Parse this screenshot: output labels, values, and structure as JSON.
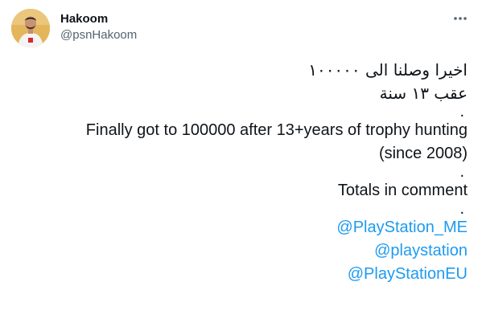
{
  "tweet": {
    "author_name": "Hakoom",
    "author_handle": "@psnHakoom",
    "more_icon": "ellipsis-icon",
    "lines": [
      "اخيرا وصلنا الى ١٠٠٠٠٠",
      "عقب ١٣ سنة",
      ".",
      "Finally got to 100000 after 13+years of trophy hunting",
      "(since 2008)",
      ".",
      "Totals in comment",
      "."
    ],
    "mentions": [
      "@PlayStation_ME",
      "@playstation",
      "@PlayStationEU"
    ]
  },
  "colors": {
    "text": "#0f1419",
    "secondary": "#536471",
    "link": "#1d9bf0"
  }
}
